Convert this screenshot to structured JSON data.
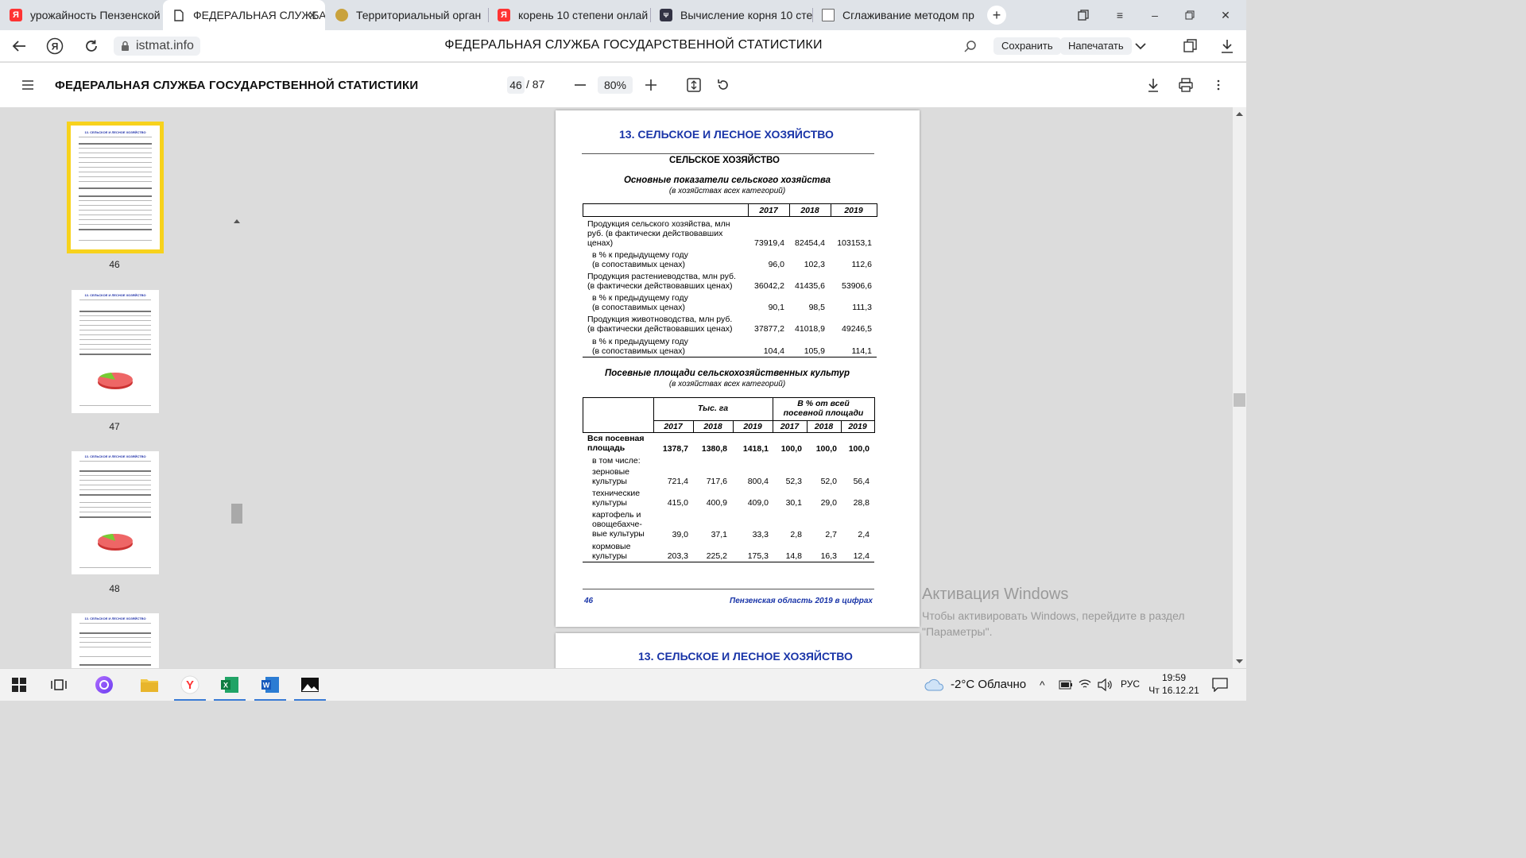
{
  "browser": {
    "tabs": [
      {
        "label": "урожайность Пензенской",
        "icon": "yandex-icon"
      },
      {
        "label": "ФЕДЕРАЛЬНАЯ СЛУЖБА",
        "icon": "document-icon",
        "active": true
      },
      {
        "label": "Территориальный орган",
        "icon": "emblem-icon"
      },
      {
        "label": "корень 10 степени онлай",
        "icon": "yandex-icon"
      },
      {
        "label": "Вычисление корня 10 сте",
        "icon": "calculator-icon"
      },
      {
        "label": "Сглаживание методом пр",
        "icon": "page-icon"
      }
    ],
    "url": "istmat.info",
    "page_title": "ФЕДЕРАЛЬНАЯ СЛУЖБА ГОСУДАРСТВЕННОЙ СТАТИСТИКИ",
    "save_label": "Сохранить",
    "print_label": "Напечатать"
  },
  "pdf_toolbar": {
    "title": "ФЕДЕРАЛЬНАЯ СЛУЖБА ГОСУДАРСТВЕННОЙ СТАТИСТИКИ",
    "current_page": "46",
    "total_pages": "/ 87",
    "zoom": "80%"
  },
  "thumbnails": [
    {
      "label": "46",
      "selected": true
    },
    {
      "label": "47"
    },
    {
      "label": "48"
    }
  ],
  "document": {
    "chapter": "13. СЕЛЬСКОЕ И ЛЕСНОЕ ХОЗЯЙСТВО",
    "section": "СЕЛЬСКОЕ ХОЗЯЙСТВО",
    "table1": {
      "title": "Основные показатели сельского хозяйства",
      "subtitle": "(в хозяйствах всех категорий)",
      "years": [
        "2017",
        "2018",
        "2019"
      ],
      "rows": [
        {
          "label": [
            "Продукция сельского хозяйства, млн",
            "руб. (в фактически действовавших",
            "ценах)"
          ],
          "values": [
            "73919,4",
            "82454,4",
            "103153,1"
          ]
        },
        {
          "label": [
            "  в % к предыдущему году",
            "  (в сопоставимых ценах)"
          ],
          "values": [
            "96,0",
            "102,3",
            "112,6"
          ]
        },
        {
          "label": [
            "Продукция растениеводства, млн руб.",
            "(в фактически действовавших ценах)"
          ],
          "values": [
            "36042,2",
            "41435,6",
            "53906,6"
          ]
        },
        {
          "label": [
            "  в % к предыдущему году",
            "  (в сопоставимых ценах)"
          ],
          "values": [
            "90,1",
            "98,5",
            "111,3"
          ]
        },
        {
          "label": [
            "Продукция животноводства, млн руб.",
            "(в фактически действовавших ценах)"
          ],
          "values": [
            "37877,2",
            "41018,9",
            "49246,5"
          ]
        },
        {
          "label": [
            "  в % к предыдущему году",
            "  (в сопоставимых ценах)"
          ],
          "values": [
            "104,4",
            "105,9",
            "114,1"
          ]
        }
      ]
    },
    "table2": {
      "title": "Посевные площади сельскохозяйственных культур",
      "subtitle": "(в хозяйствах всех категорий)",
      "group1": "Тыс. га",
      "group2": [
        "В % от всей",
        "посевной площади"
      ],
      "years": [
        "2017",
        "2018",
        "2019",
        "2017",
        "2018",
        "2019"
      ],
      "total": {
        "label": [
          "Вся посевная",
          "площадь"
        ],
        "values": [
          "1378,7",
          "1380,8",
          "1418,1",
          "100,0",
          "100,0",
          "100,0"
        ]
      },
      "including": "в том числе:",
      "rows": [
        {
          "label": [
            "зерновые",
            "культуры"
          ],
          "values": [
            "721,4",
            "717,6",
            "800,4",
            "52,3",
            "52,0",
            "56,4"
          ]
        },
        {
          "label": [
            "технические",
            "культуры"
          ],
          "values": [
            "415,0",
            "400,9",
            "409,0",
            "30,1",
            "29,0",
            "28,8"
          ]
        },
        {
          "label": [
            "картофель и",
            "овощебахче-",
            "вые культуры"
          ],
          "values": [
            "39,0",
            "37,1",
            "33,3",
            "2,8",
            "2,7",
            "2,4"
          ]
        },
        {
          "label": [
            "кормовые",
            "культуры"
          ],
          "values": [
            "203,3",
            "225,2",
            "175,3",
            "14,8",
            "16,3",
            "12,4"
          ]
        }
      ]
    },
    "footer_page": "46",
    "footer_title": "Пензенская область 2019 в цифрах",
    "next_chapter": "13. СЕЛЬСКОЕ И ЛЕСНОЕ ХОЗЯЙСТВО"
  },
  "watermark": {
    "title": "Активация Windows",
    "text1": "Чтобы активировать Windows, перейдите в раздел",
    "text2": "\"Параметры\"."
  },
  "taskbar": {
    "weather": "-2°C  Облачно",
    "lang": "РУС",
    "time": "19:59",
    "date": "Чт 16.12.21"
  }
}
